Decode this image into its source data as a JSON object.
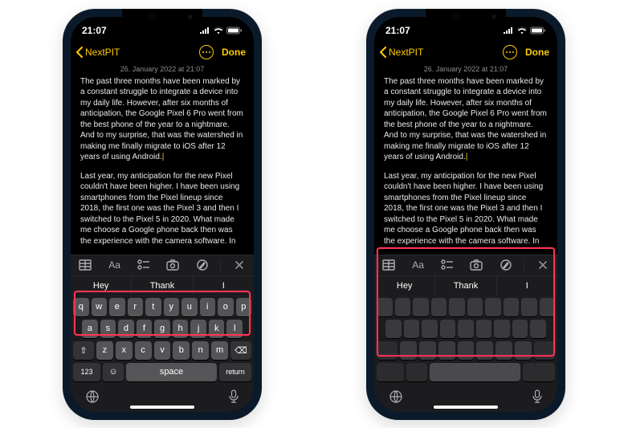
{
  "status": {
    "time": "21:07"
  },
  "nav": {
    "back": "NextPIT",
    "done": "Done"
  },
  "note": {
    "date": "26. January 2022 at 21:07",
    "p1": "The past three months have been marked by a constant struggle to integrate a device into my daily life. However, after six months of anticipation, the Google Pixel 6 Pro went from the best phone of the year to a nightmare. And to my surprise, that was the watershed in making me finally migrate to iOS after 12 years of using Android.",
    "p2": "Last year, my anticipation for the new Pixel couldn't have been higher. I have been using smartphones from the Pixel lineup since 2018, the first one was the Pixel 3 and then I switched to the Pixel 5 in 2020. What made me choose a Google phone back then was the experience with the camera software. In"
  },
  "toolbar": {
    "aa": "Aa"
  },
  "suggestions": [
    "Hey",
    "Thank",
    "I"
  ],
  "keyboard": {
    "row1": [
      "q",
      "w",
      "e",
      "r",
      "t",
      "y",
      "u",
      "i",
      "o",
      "p"
    ],
    "row2": [
      "a",
      "s",
      "d",
      "f",
      "g",
      "h",
      "j",
      "k",
      "l"
    ],
    "row3": [
      "z",
      "x",
      "c",
      "v",
      "b",
      "n",
      "m"
    ],
    "shift": "⇧",
    "backspace": "⌫",
    "numbers": "123",
    "emoji": "☺",
    "space": "space",
    "return": "return"
  }
}
